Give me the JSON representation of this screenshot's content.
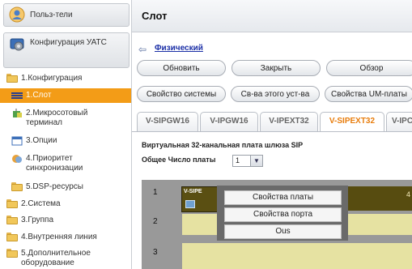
{
  "sidebar": {
    "users_label": "Польз-тели",
    "config_label": "Конфигурация УАТС",
    "tree": [
      {
        "label": "1.Конфигурация"
      },
      {
        "label": "1.Слот"
      },
      {
        "label": "2.Микросотовый терминал"
      },
      {
        "label": "3.Опции"
      },
      {
        "label": "4.Приоритет синхронизации"
      },
      {
        "label": "5.DSP-ресурсы"
      },
      {
        "label": "2.Система"
      },
      {
        "label": "3.Группа"
      },
      {
        "label": "4.Внутренняя линия"
      },
      {
        "label": "5.Дополнительное оборудование"
      }
    ]
  },
  "header": {
    "title": "Слот"
  },
  "back_link": "Физический",
  "buttons": {
    "refresh": "Обновить",
    "close": "Закрыть",
    "browse": "Обзор",
    "system_props": "Свойство системы",
    "device_props": "Св-ва этого уст-ва",
    "um_props": "Свойства UM-платы"
  },
  "tabs": [
    "V-SIPGW16",
    "V-IPGW16",
    "V-IPEXT32",
    "V-SIPEXT32",
    "V-IPC"
  ],
  "active_tab": 3,
  "info": {
    "description": "Виртуальная 32-канальная плата шлюза SIP",
    "count_label": "Общее Число платы",
    "count_value": "1"
  },
  "slots": [
    "1",
    "2",
    "3"
  ],
  "card": {
    "name": "V-SIPE",
    "right_number": "4"
  },
  "popup": {
    "card_props": "Свойства платы",
    "port_props": "Свойства порта",
    "ous": "Ous"
  },
  "colors": {
    "selected": "#f39c17",
    "active_tab": "#e87d0d",
    "link": "#1a2ea6",
    "slot_row": "#e6e2a2"
  }
}
